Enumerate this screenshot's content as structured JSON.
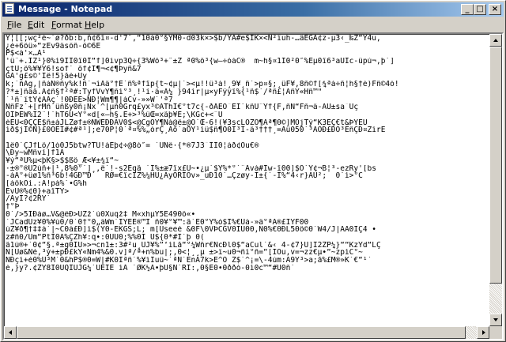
{
  "window": {
    "title": "Message - Notepad",
    "buttons": {
      "minimize": "_",
      "maximize": "□",
      "close": "×"
    }
  },
  "menu": [
    {
      "first": "F",
      "rest": "ile"
    },
    {
      "first": "E",
      "rest": "dit"
    },
    {
      "first": "F",
      "rest": "ormat"
    },
    {
      "first": "H",
      "rest": "elp"
    }
  ],
  "content": {
    "lines": [
      "Y¦[[;wç²è~`ø?ðb:b,ñ¢6î¤-d'7ˆ,“10à0°§ÝM0-d03k×>$b/YÁ#e$IK×<Ñ²ïuh-…äEGÁ¢z-µ3‹_‰Z“Ý4u,",
      "¿é+6öü»“zEv9äsöñ-ô©6É",
      "P$<à'×…À¹",
      "'ü˜+.ÌZ¹}0%ì9ÏÎ0î0Ï“f]0ivp3Q÷{3%Wö³+ˆ±Ž ª0%ô³{w–÷óáC®  m~h§¤1Ì0²0″%Eµ0î6³aÙÎc-üpú¬,þ`]",
      "çtÜ;ô%¥¥Ý6!sof` õf¢Í¶¬<¢¶Þyñ&7",
      "GÀ'g£s©'Îê!5}åé+Üy",
      "k;`ñÁg,|ñàÑ®ñy%k!ñ`¬ìÁä°†Ê`ñ%ªfîp{t~¢µ|`><µ!!û³à!¸9¥¸ñ`>p¤§;¸ûF¥,8ñ©f[¾ªá÷ñ¦h§†é)Fñ©4ó!",
      "?*±]ñâå.Á¢ñ§f²ª#:TyfVvŸ¶ñì°³¸!¹í·ä«À¼ }94ìr|µ×yFÿÿî%{¹ñ$´/ªñ£¦ÁñÝ«Hñ™\"",
      "`¹ñ`ïtY¢ÃÅç`!0ÐÉE>ÑÐ¦Wm¶¶|àCv-»»W`'ª7",
      "ÑñFz`+[rMñ`üñßy0ñ¡Ñx`^[µñ0Grq£yx³©ÄThÎ€°t7c{-ðÅEO¯ÊÎ`kñÜ¨Yf{F,ñN“Fñ¬ä-AÙ±sa¯Ûç",
      "ÒÎÞEW%Ï2¨!`hT6Ú<Ý°«d[«—h§.E+>³%üŒ=xãþ¥E;\\KGc+<¨U",
      "èEÙ<0ÇÇE$ñ±àJLZøf±®ÑWEÐÐÁV0$<@CgÒÝ¶Nà@ê±@Õ`Œ-6!(¥3scLÒZÓ¶Àª¶0©]MÖjTý“K3ÊÇ€t&ÞÝEÜ",
      "ìð$jÎ©Ñ}£0ÓEÎ#¢#ª¹];e70P¦0`ª¤%%„órÇ¸Åõ`aOÝ¹ìü$ñ¶Ô0Ì³Ì-ä³†††¸=Åü050`³AÓÐ£ÐÕ³EñÇÐ¤ZìrE",
      "",
      "1ê0`ÇJfLö/1ó0J5btw?TU!àEþ¢÷@8ò″= `ÙNë·{*®7J3¯ÏÏ0¦àð¢Õu€®",
      "\\Ðy~wMñví]f1À",
      "¥ý“ªÚ%µ<þK§>$$ßö_Æ<¥±¾ï“~",
      "·±®°®Ü2úñ+|¹,8%0°`]¸,ë`!-s2Eqã `Ì%±æ7îx£Ü~•¿µ`$Ý%*°`¨Àvá#Ïw-î00]$Ö`Ý¢¬B¦³-ezRy'[bs",
      "-àÀ°+üø1%ñ³6b!4GÐ™Ð`  RØ=€îcÏZ%¼HÜ¿ÁyÖRÏÓv»_uÐ10`…Çzøy-Ì±{`-Ì%“4‹r}ÀÚ²;  0`ì>°C",
      "[àôkÒì.:À!pà%`•G%h",
      "EvÙ®%¢0}+aîTY>",
      "/ÂyÏ?¢2RY`",
      "†°Þ",
      "0`/>5ÏÐàø…V&@ëÐ>UZž`ù0Xuqž‡ M«xhµÝ5È490ô«•",
      "`JCadÛz¥0%¥ú0/0`0†°0„äWm`IÝEE®™Ï ñ0¥°¥™:ã`E0°Ý%ò$Ï%€Uá-»ä°ªA®£ÎYF00",
      "úZ¥ð¶†‡‡à`|~C0à£Ð]ì$(Ý0-EKGS;L; m[Useeé &0F\\0VÞCGV0ÍÙ00,Ñ0%€0ÐL50ô©0`W4/J|ÁÁ0ÏÇ4 •",
      "z#ñ0/Um“PtÏ0À%ÇZh¥:q•:0ÙÙ0;%%0Ï Ù${0*#Ì`þ 0(",
      "ã1ú®+`0¢“§.ª±g0ÍÙ»>¬cn1±:3#²u¸ÙJ¥%”‘ìLå“°¼Wñr€ÑcÐl0$“aCul`&‹ 4-¢7}Ú]Ï2ZP¼}““KzÝd“LÇ",
      "N[Ûø&Ñè,³ý+±pÐ£kÝ«Nm4%&0.v]ª/ª+n%bu|;,0<¦¸¸µ ±>ï~u0¬ñì°ñ=“[ÍÖu,v=¬zz€µ•“~zpìC°~",
      "NÐçì+é0%Û³M`0&hP$®0=W|#K0Îªñ`%¥ìÎuü~`ªÑ`EnÀ7k>E^Ò Z$`^¡=\\-4úm:A9Ý³>a;å%£M®»K`€“¹´",
      "è,}y?.¢ZÝ8Ì0ÙQÌÙJG¼`ÙÉÏE ìÅ `ØK½Á•þÚ§Ñ`RÍ:,0§E0•0ððó-0ì0c™“#U0ñ`"
    ]
  },
  "colors": {
    "face": "#d4d0c8",
    "title_gradient_start": "#0a246a",
    "title_gradient_end": "#a6caf0",
    "editor_bg": "#ffffff"
  },
  "icons": [
    "notepad-icon",
    "minimize-icon",
    "maximize-icon",
    "close-icon",
    "scroll-up-arrow-icon",
    "scroll-down-arrow-icon",
    "scroll-left-arrow-icon",
    "scroll-right-arrow-icon"
  ]
}
